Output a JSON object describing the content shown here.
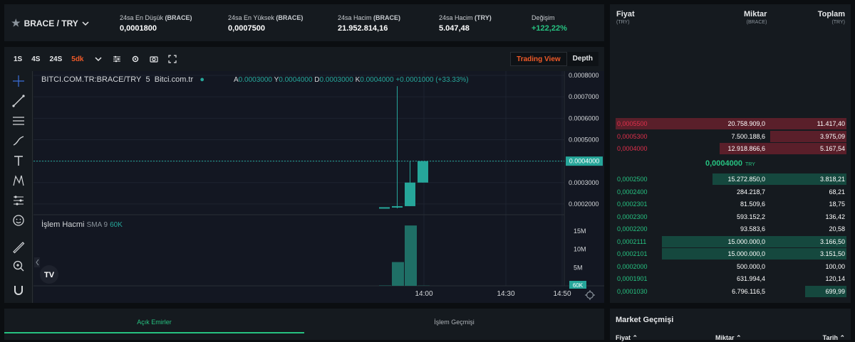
{
  "ticker": {
    "pair": "BRACE / TRY",
    "stats": [
      {
        "label_prefix": "24sa En Düşük ",
        "label_bold": "(BRACE)",
        "value": "0,0001800"
      },
      {
        "label_prefix": "24sa En Yüksek ",
        "label_bold": "(BRACE)",
        "value": "0,0007500"
      },
      {
        "label_prefix": "24sa Hacim ",
        "label_bold": "(BRACE)",
        "value": "21.952.814,16"
      },
      {
        "label_prefix": "24sa Hacim ",
        "label_bold": "(TRY)",
        "value": "5.047,48"
      },
      {
        "label_prefix": "Değişim",
        "label_bold": "",
        "value": "+122,22%"
      }
    ]
  },
  "toolbar": {
    "intervals": [
      "1S",
      "4S",
      "24S",
      "5dk"
    ],
    "active_interval": "5dk",
    "views": [
      "Trading View",
      "Depth"
    ],
    "active_view": "Trading View"
  },
  "chart": {
    "symbol": "BITCI.COM.TR:BRACE/TRY",
    "interval": "5",
    "source": "Bitci.com.tr",
    "ohlc": "A0.0003000 Y0.0004000 D0.0003000 K0.0004000 +0.0001000 (+33.33%)",
    "ohlc_parts": {
      "A": "0.0003000",
      "Y": "0.0004000",
      "D": "0.0003000",
      "K": "0.0004000",
      "chg": "+0.0001000 (+33.33%)"
    },
    "volume_label": "İşlem Hacmi",
    "volume_indicator": "SMA 9",
    "volume_value": "60K",
    "price_ticks": [
      "0.0008000",
      "0.0007000",
      "0.0006000",
      "0.0005000",
      "0.0004000",
      "0.0003000",
      "0.0002000"
    ],
    "last_price": "0.0004000",
    "volume_ticks": [
      "15M",
      "10M",
      "5M"
    ],
    "volume_last": "60K",
    "time_ticks": [
      "14:00",
      "14:30",
      "14:50"
    ],
    "logo_text": "TV"
  },
  "chart_data": {
    "type": "candlestick",
    "price_ylim": [
      0.00015,
      0.00082
    ],
    "candles": [
      {
        "o": 0.00018,
        "h": 0.000185,
        "l": 0.00018,
        "c": 0.000185
      },
      {
        "o": 0.000185,
        "h": 0.00075,
        "l": 0.00018,
        "c": 0.00019
      },
      {
        "o": 0.00019,
        "h": 0.0004,
        "l": 0.00019,
        "c": 0.0003
      },
      {
        "o": 0.0003,
        "h": 0.0004,
        "l": 0.0003,
        "c": 0.0004
      }
    ],
    "volumes_m": [
      0.1,
      6.5,
      16.5,
      0.06
    ]
  },
  "orderbook": {
    "headers": [
      {
        "title": "Fiyat",
        "unit": "(TRY)"
      },
      {
        "title": "Miktar",
        "unit": "(BRACE)"
      },
      {
        "title": "Toplam",
        "unit": "(TRY)"
      }
    ],
    "asks": [
      {
        "price": "0,0005500",
        "amount": "20.758.909,0",
        "total": "11.417,40",
        "depth": 1.0
      },
      {
        "price": "0,0005300",
        "amount": "7.500.188,6",
        "total": "3.975,09",
        "depth": 0.33
      },
      {
        "price": "0,0004000",
        "amount": "12.918.866,6",
        "total": "5.167,54",
        "depth": 0.55
      }
    ],
    "mid_price": "0,0004000",
    "mid_unit": "TRY",
    "bids": [
      {
        "price": "0,0002500",
        "amount": "15.272.850,0",
        "total": "3.818,21",
        "depth": 0.58
      },
      {
        "price": "0,0002400",
        "amount": "284.218,7",
        "total": "68,21",
        "depth": 0.0
      },
      {
        "price": "0,0002301",
        "amount": "81.509,6",
        "total": "18,75",
        "depth": 0.0
      },
      {
        "price": "0,0002300",
        "amount": "593.152,2",
        "total": "136,42",
        "depth": 0.0
      },
      {
        "price": "0,0002200",
        "amount": "93.583,6",
        "total": "20,58",
        "depth": 0.0
      },
      {
        "price": "0,0002111",
        "amount": "15.000.000,0",
        "total": "3.166,50",
        "depth": 0.8
      },
      {
        "price": "0,0002101",
        "amount": "15.000.000,0",
        "total": "3.151,50",
        "depth": 0.8
      },
      {
        "price": "0,0002000",
        "amount": "500.000,0",
        "total": "100,00",
        "depth": 0.0
      },
      {
        "price": "0,0001901",
        "amount": "631.994,4",
        "total": "120,14",
        "depth": 0.0
      },
      {
        "price": "0,0001030",
        "amount": "6.796.116,5",
        "total": "699,99",
        "depth": 0.18
      }
    ]
  },
  "orders": {
    "tabs": [
      "Açık Emirler",
      "İşlem Geçmişi"
    ]
  },
  "market": {
    "title": "Market Geçmişi",
    "headers": [
      "Fiyat",
      "Miktar",
      "Tarih"
    ]
  },
  "colors": {
    "up": "#26a69a",
    "down": "#e0304c",
    "accent": "#f05a28"
  }
}
